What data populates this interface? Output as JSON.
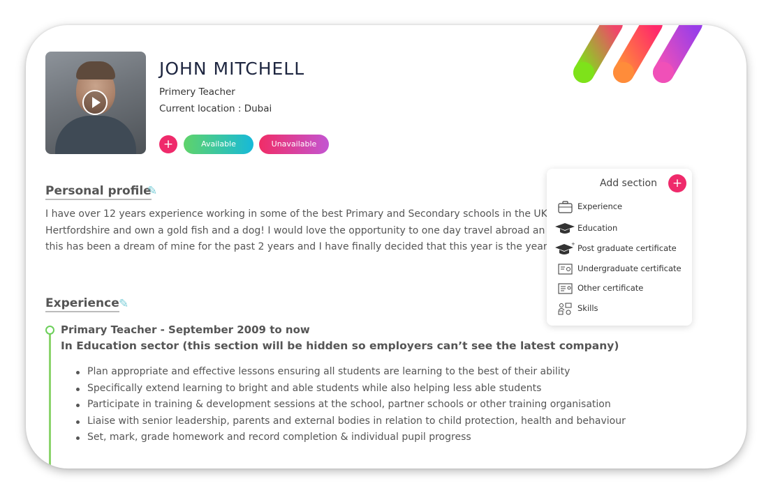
{
  "profile": {
    "name": "JOHN MITCHELL",
    "role": "Primery Teacher",
    "location": "Current location : Dubai",
    "add_label": "+",
    "available_label": "Available",
    "unavailable_label": "Unavailable"
  },
  "personal_profile": {
    "heading": "Personal profile",
    "lines": [
      "I have over 12 years experience working in some of the best Primary and Secondary schools in the UK.",
      "Hertfordshire and own a gold fish and a dog! I would love the opportunity to one day travel abroad an",
      "this has been a dream of mine for the past 2 years and I have finally decided that this year is the year t"
    ]
  },
  "experience": {
    "heading": "Experience",
    "job_title": "Primary Teacher - September 2009 to now",
    "sector": "In Education sector (this section will be hidden so employers can’t see the latest company)",
    "duties": [
      "Plan appropriate and effective lessons ensuring all students are learning to the best of their ability",
      "Specifically extend learning to bright and able students while also helping less able students",
      "Participate in training & development sessions at the school, partner schools or other training organisation",
      "Liaise with senior leadership, parents and external bodies in relation to child protection, health and behaviour",
      "Set, mark, grade homework and record completion & individual pupil progress"
    ]
  },
  "add_section": {
    "title": "Add section",
    "plus": "+",
    "items": [
      {
        "label": "Experience",
        "icon": "briefcase-icon"
      },
      {
        "label": "Education",
        "icon": "graduation-cap-icon"
      },
      {
        "label": "Post graduate certificate",
        "icon": "graduation-cap-plus-icon"
      },
      {
        "label": "Undergraduate certificate",
        "icon": "certificate-icon"
      },
      {
        "label": "Other certificate",
        "icon": "document-icon"
      },
      {
        "label": "Skills",
        "icon": "skills-icon"
      }
    ]
  },
  "colors": {
    "accent_pink": "#ef2a6b",
    "available_gradient": [
      "#5fd36a",
      "#17b9d9"
    ],
    "unavailable_gradient": [
      "#f02d67",
      "#c355d2"
    ],
    "timeline_green": "#8bd46c"
  }
}
